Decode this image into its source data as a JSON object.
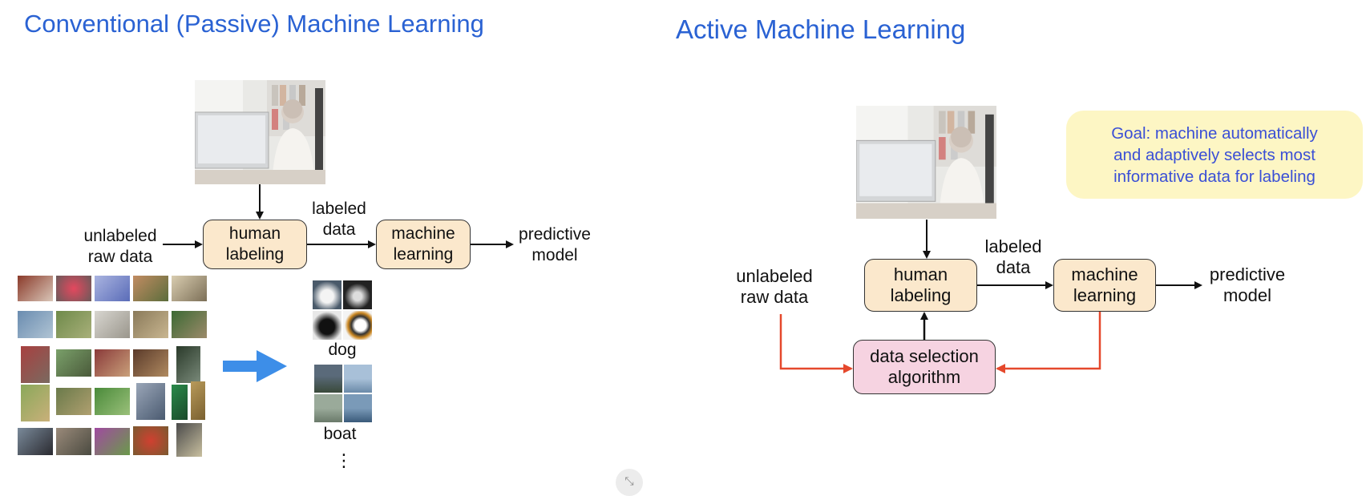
{
  "left": {
    "title": "Conventional (Passive) Machine Learning",
    "input_label": "unlabeled\nraw data",
    "box_human": "human\nlabeling",
    "edge_label": "labeled\ndata",
    "box_ml": "machine\nlearning",
    "output_label": "predictive\nmodel",
    "class_dog": "dog",
    "class_boat": "boat",
    "ellipsis": "⋮"
  },
  "right": {
    "title": "Active Machine Learning",
    "goal": "Goal: machine automatically\nand adaptively selects most\ninformative data for labeling",
    "input_label": "unlabeled\nraw data",
    "box_human": "human\nlabeling",
    "edge_label": "labeled\ndata",
    "box_ml": "machine\nlearning",
    "output_label": "predictive\nmodel",
    "box_selection": "data selection\nalgorithm"
  },
  "colors": {
    "title": "#2a62d3",
    "box_fill": "#fbe8cc",
    "selection_fill": "#f6d3e1",
    "feedback_arrow": "#e5482c",
    "big_arrow": "#3d8ee8",
    "goal_fill": "#fdf6c4",
    "goal_text": "#3a4fd6"
  },
  "icons": {
    "fullscreen": "fullscreen-exit-icon"
  }
}
